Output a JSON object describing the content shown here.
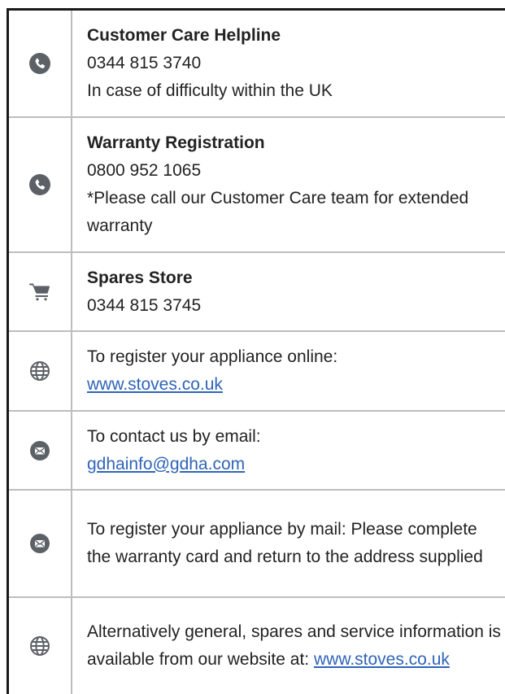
{
  "rows": [
    {
      "icon": "phone-icon",
      "title": "Customer Care Helpline",
      "phone": "0344 815 3740",
      "note": "In case of difficulty within the UK"
    },
    {
      "icon": "phone-icon",
      "title": "Warranty Registration",
      "phone": "0800 952 1065",
      "note": "*Please call our Customer Care team for extended warranty"
    },
    {
      "icon": "cart-icon",
      "title": "Spares Store",
      "phone": "0344 815 3745"
    },
    {
      "icon": "globe-icon",
      "text": "To register your appliance online:",
      "link": "www.stoves.co.uk"
    },
    {
      "icon": "mail-icon",
      "text": "To contact us by email:",
      "link": "gdhainfo@gdha.com"
    },
    {
      "icon": "mail-icon",
      "text": "To register your appliance by mail: Please complete the warranty card and return to the address supplied"
    },
    {
      "icon": "globe-icon",
      "text": "Alternatively general, spares and service information is available from our website at:",
      "link": "www.stoves.co.uk"
    }
  ],
  "colors": {
    "icon": "#5b6166",
    "link": "#2f64b8",
    "divider": "#bdbdbd",
    "outer_border": "#1a1a1a"
  }
}
